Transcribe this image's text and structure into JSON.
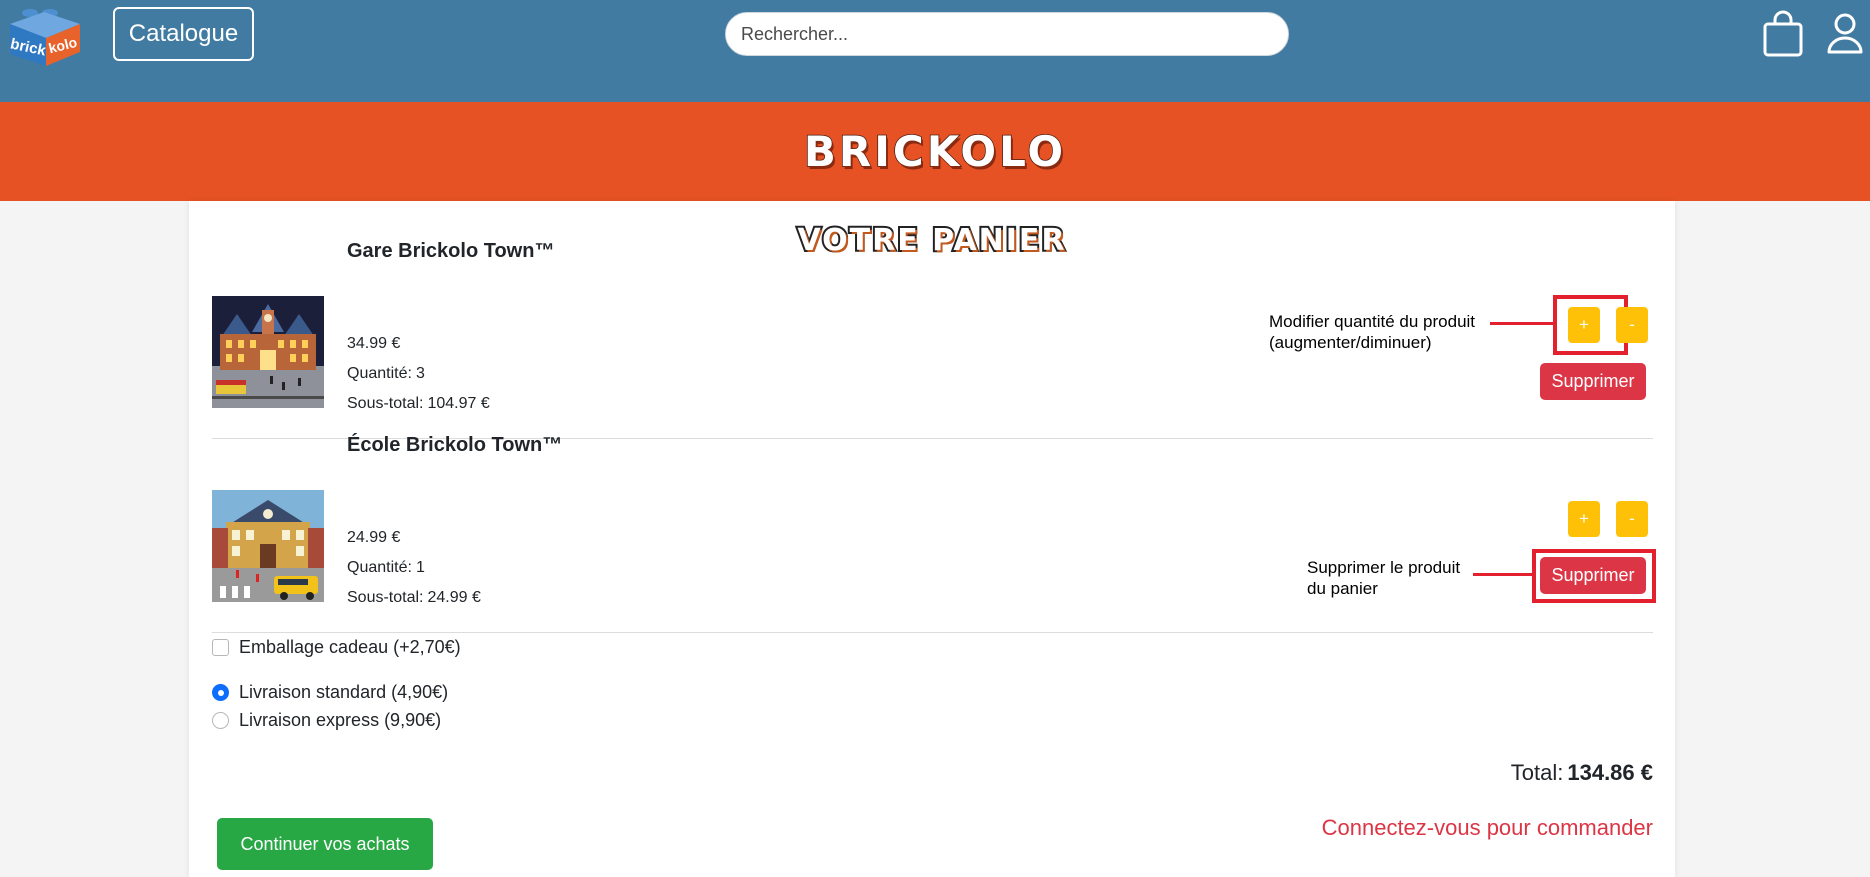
{
  "header": {
    "logo_text_left": "brick",
    "logo_text_right": "kolo",
    "catalogue_label": "Catalogue",
    "search_placeholder": "Rechercher...",
    "bag_icon": "shopping-bag-icon",
    "user_icon": "user-icon",
    "brand_color": "#417ba1"
  },
  "banner": {
    "title": "BRICKOLO",
    "color": "#e65224"
  },
  "cart": {
    "title": "VOTRE PANIER",
    "items": [
      {
        "name": "Gare Brickolo Town™",
        "price": "34.99 €",
        "quantity_label": "Quantité:",
        "quantity": "3",
        "subtotal_label": "Sous-total:",
        "subtotal": "104.97 €",
        "plus_label": "+",
        "minus_label": "-",
        "delete_label": "Supprimer"
      },
      {
        "name": "École Brickolo Town™",
        "price": "24.99 €",
        "quantity_label": "Quantité:",
        "quantity": "1",
        "subtotal_label": "Sous-total:",
        "subtotal": "24.99 €",
        "plus_label": "+",
        "minus_label": "-",
        "delete_label": "Supprimer"
      }
    ],
    "annotations": {
      "quantity_line1": "Modifier quantité du produit",
      "quantity_line2": "(augmenter/diminuer)",
      "delete_line1": "Supprimer le produit",
      "delete_line2": "du panier",
      "highlight_color": "#e3202e"
    },
    "options": {
      "gift_wrap": {
        "label": "Emballage cadeau (+2,70€)",
        "checked": false
      },
      "shipping": [
        {
          "label": "Livraison standard (4,90€)",
          "checked": true
        },
        {
          "label": "Livraison express (9,90€)",
          "checked": false
        }
      ]
    },
    "total_label": "Total:",
    "total_value": "134.86 €",
    "continue_label": "Continuer vos achats",
    "login_label": "Connectez-vous pour commander"
  }
}
